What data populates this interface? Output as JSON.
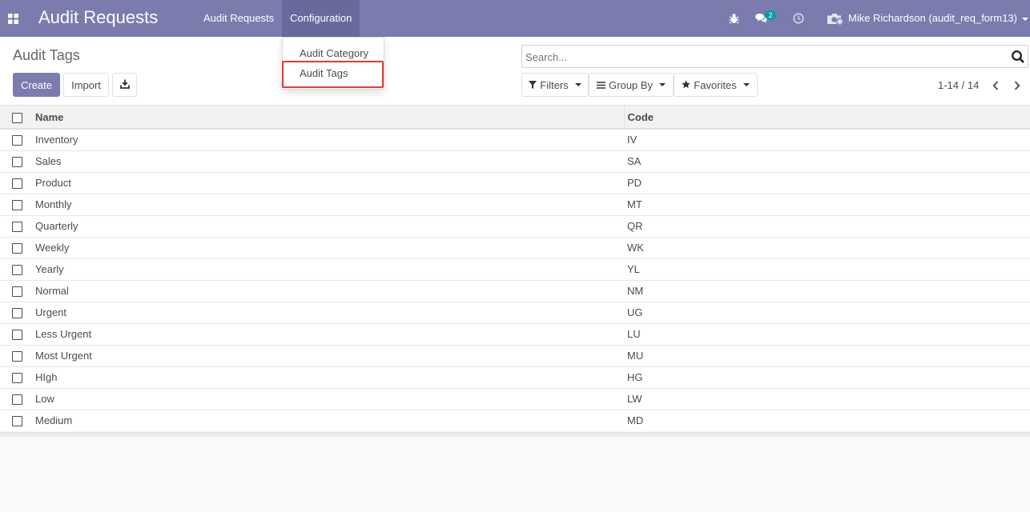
{
  "app": {
    "brand": "Audit Requests",
    "menu": [
      {
        "label": "Audit Requests",
        "active": false
      },
      {
        "label": "Configuration",
        "active": true
      }
    ],
    "notification_count": "2",
    "user": "Mike Richardson (audit_req_form13)",
    "accent_color": "#7c7bad"
  },
  "config_menu": {
    "items": [
      {
        "label": "Audit Category",
        "highlighted": false
      },
      {
        "label": "Audit Tags",
        "highlighted": true
      }
    ],
    "highlight_color": "#e53935"
  },
  "page": {
    "title": "Audit Tags",
    "buttons": {
      "create": "Create",
      "import": "Import"
    },
    "search_placeholder": "Search...",
    "filters": "Filters",
    "group_by": "Group By",
    "favorites": "Favorites",
    "pager": "1-14 / 14"
  },
  "table": {
    "columns": [
      "Name",
      "Code"
    ],
    "rows": [
      {
        "name": "Inventory",
        "code": "IV"
      },
      {
        "name": "Sales",
        "code": "SA"
      },
      {
        "name": "Product",
        "code": "PD"
      },
      {
        "name": "Monthly",
        "code": "MT"
      },
      {
        "name": "Quarterly",
        "code": "QR"
      },
      {
        "name": "Weekly",
        "code": "WK"
      },
      {
        "name": "Yearly",
        "code": "YL"
      },
      {
        "name": "Normal",
        "code": "NM"
      },
      {
        "name": "Urgent",
        "code": "UG"
      },
      {
        "name": "Less Urgent",
        "code": "LU"
      },
      {
        "name": "Most Urgent",
        "code": "MU"
      },
      {
        "name": "HIgh",
        "code": "HG"
      },
      {
        "name": "Low",
        "code": "LW"
      },
      {
        "name": "Medium",
        "code": "MD"
      }
    ]
  }
}
